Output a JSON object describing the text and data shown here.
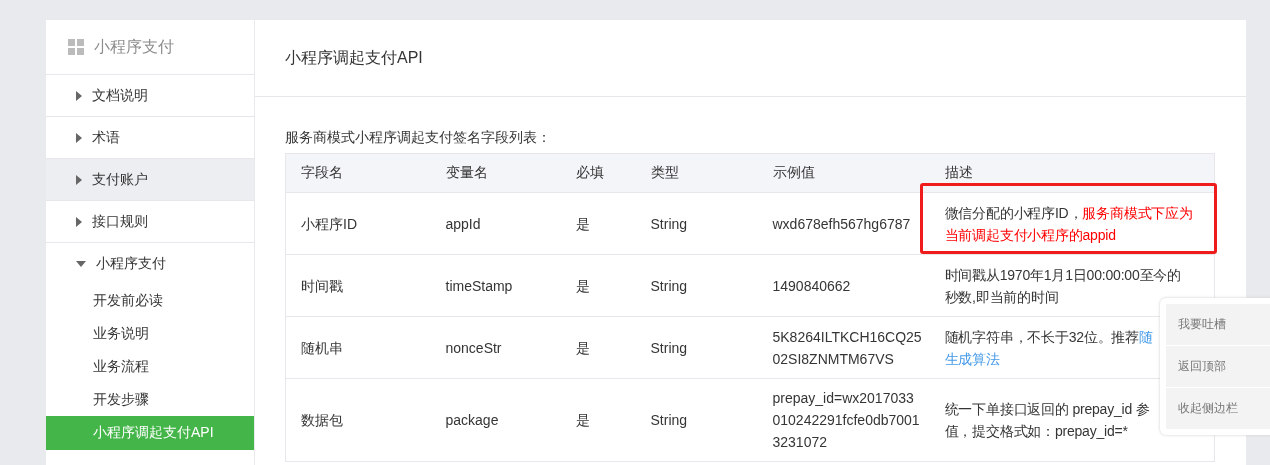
{
  "sidebar": {
    "title": "小程序支付",
    "items": [
      {
        "label": "文档说明",
        "expanded": false,
        "highlighted": false
      },
      {
        "label": "术语",
        "expanded": false,
        "highlighted": false
      },
      {
        "label": "支付账户",
        "expanded": false,
        "highlighted": true
      },
      {
        "label": "接口规则",
        "expanded": false,
        "highlighted": false
      },
      {
        "label": "小程序支付",
        "expanded": true,
        "highlighted": false,
        "children": [
          {
            "label": "开发前必读",
            "selected": false
          },
          {
            "label": "业务说明",
            "selected": false
          },
          {
            "label": "业务流程",
            "selected": false
          },
          {
            "label": "开发步骤",
            "selected": false
          },
          {
            "label": "小程序调起支付API",
            "selected": true
          }
        ]
      }
    ]
  },
  "content": {
    "title": "小程序调起支付API",
    "caption": "服务商模式小程序调起支付签名字段列表：",
    "table": {
      "columns": [
        "字段名",
        "变量名",
        "必填",
        "类型",
        "示例值",
        "描述"
      ],
      "rows": [
        {
          "cells": [
            "小程序ID",
            "appId",
            "是",
            "String",
            [
              "wxd678efh567hg6787"
            ]
          ],
          "highlighted": true,
          "description": [
            [
              {
                "kind": "text",
                "text": "微信分配的小程序ID，"
              },
              {
                "kind": "emph",
                "text": "服务商模式下应为"
              }
            ],
            [
              {
                "kind": "emph",
                "text": "当前调起支付小程序的appid"
              }
            ]
          ]
        },
        {
          "cells": [
            "时间戳",
            "timeStamp",
            "是",
            "String",
            [
              "1490840662"
            ]
          ],
          "highlighted": false,
          "description": [
            [
              {
                "kind": "text",
                "text": "时间戳从1970年1月1日00:00:00至今的"
              }
            ],
            [
              {
                "kind": "text",
                "text": "秒数,即当前的时间"
              }
            ]
          ]
        },
        {
          "cells": [
            "随机串",
            "nonceStr",
            "是",
            "String",
            [
              "5K8264ILTKCH16CQ25",
              "02SI8ZNMTM67VS"
            ]
          ],
          "highlighted": false,
          "description": [
            [
              {
                "kind": "text",
                "text": "随机字符串，不长于32位。推荐"
              },
              {
                "kind": "link",
                "text": "随"
              }
            ],
            [
              {
                "kind": "link",
                "text": "生成算法"
              }
            ]
          ]
        },
        {
          "cells": [
            "数据包",
            "package",
            "是",
            "String",
            [
              "prepay_id=wx2017033",
              "010242291fcfe0db7001",
              "3231072"
            ]
          ],
          "highlighted": false,
          "description": [
            [
              {
                "kind": "text",
                "text": "统一下单接口返回的 prepay_id 参"
              }
            ],
            [
              {
                "kind": "text",
                "text": "值，提交格式如：prepay_id=*"
              }
            ]
          ]
        }
      ]
    }
  },
  "float_panel": [
    "我要吐槽",
    "返回顶部",
    "收起侧边栏"
  ]
}
